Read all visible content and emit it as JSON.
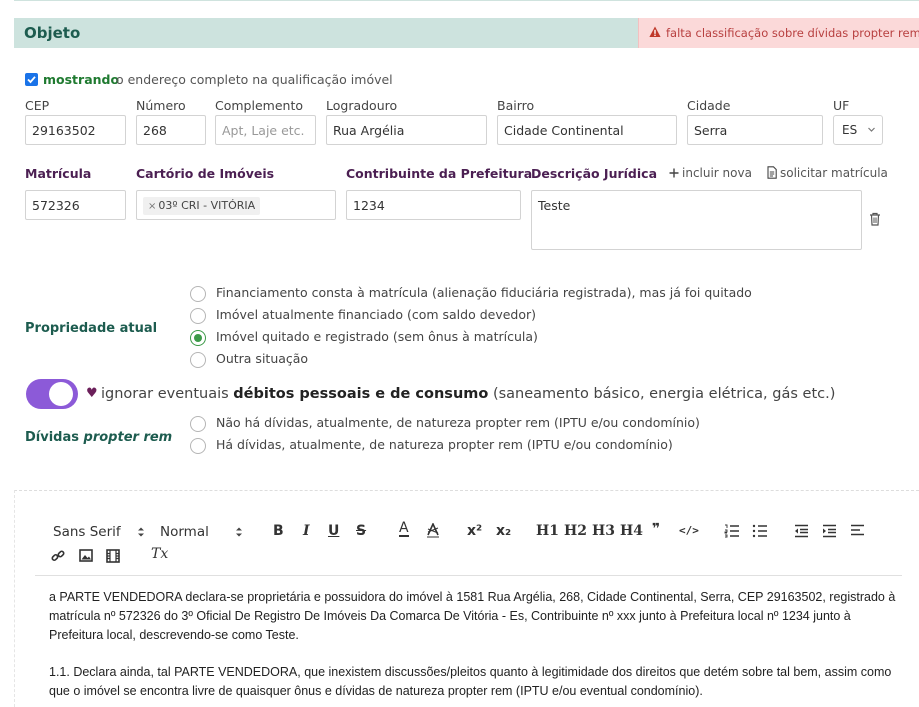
{
  "section": {
    "title": "Objeto",
    "warning": "falta classificação sobre dívidas propter rem"
  },
  "address": {
    "checkbox_strong": "mostrando",
    "checkbox_rest": "o endereço completo na qualificação imóvel",
    "labels": {
      "cep": "CEP",
      "numero": "Número",
      "complemento": "Complemento",
      "logradouro": "Logradouro",
      "bairro": "Bairro",
      "cidade": "Cidade",
      "uf": "UF"
    },
    "values": {
      "cep": "29163502",
      "numero": "268",
      "complemento_placeholder": "Apt, Laje etc.",
      "logradouro": "Rua Argélia",
      "bairro": "Cidade Continental",
      "cidade": "Serra",
      "uf": "ES"
    }
  },
  "registry": {
    "labels": {
      "matricula": "Matrícula",
      "cartorio": "Cartório de Imóveis",
      "contribuinte": "Contribuinte da Prefeitura",
      "descricao": "Descrição Jurídica"
    },
    "actions": {
      "incluir": "incluir nova",
      "solicitar": "solicitar matrícula"
    },
    "values": {
      "matricula": "572326",
      "cartorio_chip": "03º CRI - VITÓRIA",
      "contribuinte": "1234",
      "descricao": "Teste"
    }
  },
  "propriedade": {
    "label": "Propriedade atual",
    "options": [
      "Financiamento consta à matrícula (alienação fiduciária registrada), mas já foi quitado",
      "Imóvel atualmente financiado (com saldo devedor)",
      "Imóvel quitado e registrado (sem ônus à matrícula)",
      "Outra situação"
    ],
    "selected_index": 2
  },
  "debitos": {
    "toggle_on": true,
    "prefix": "ignorar eventuais",
    "bold": "débitos pessoais e de consumo",
    "suffix": "(saneamento básico, energia elétrica, gás etc.)"
  },
  "dividas": {
    "label_prefix": "Dívidas",
    "label_italic": "propter rem",
    "options": [
      "Não há dívidas, atualmente, de natureza propter rem (IPTU e/ou condomínio)",
      "Há dívidas, atualmente, de natureza propter rem (IPTU e/ou condomínio)"
    ]
  },
  "editor": {
    "font_select": "Sans Serif",
    "size_select": "Normal",
    "toolbar": {
      "bold": "B",
      "italic": "I",
      "underline": "U",
      "strike": "S",
      "color": "A",
      "superscript": "x²",
      "subscript": "x₂",
      "h1": "H1",
      "h2": "H2",
      "h3": "H3",
      "h4": "H4",
      "quote": "❞",
      "code": "</>",
      "clear": "Tx"
    },
    "paragraphs": [
      "a PARTE VENDEDORA declara-se proprietária e possuidora do imóvel à 1581 Rua Argélia, 268, Cidade Continental, Serra, CEP 29163502, registrado à matrícula nº 572326 do 3º Oficial De Registro De Imóveis Da Comarca De Vitória - Es, Contribuinte nº xxx junto à Prefeitura local nº 1234 junto à Prefeitura local, descrevendo-se como Teste.",
      "1.1. Declara ainda, tal PARTE VENDEDORA, que inexistem discussões/pleitos quanto à legitimidade dos direitos que detém sobre tal bem, assim como que o imóvel se encontra livre de quaisquer ônus e dívidas de natureza propter rem (IPTU e/ou eventual condomínio)."
    ]
  }
}
